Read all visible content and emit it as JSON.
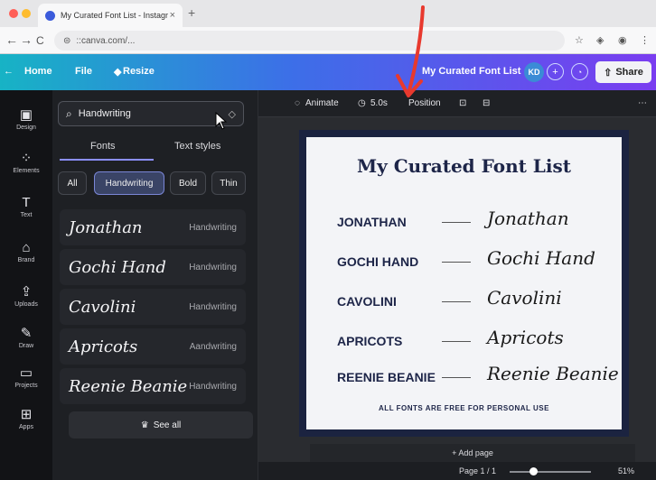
{
  "browser": {
    "tab_title": "My Curated Font List - Instagr",
    "tab_close": "×",
    "new_tab": "+",
    "url": "::canva.com/...",
    "nav_back": "←",
    "nav_forward": "→",
    "reload": "C"
  },
  "topbar": {
    "home": "Home",
    "file": "File",
    "resize": "Resize",
    "doc_title": "My Curated Font List",
    "avatar": "KD",
    "share": "Share"
  },
  "rail": [
    {
      "label": "Design",
      "icon": "▣"
    },
    {
      "label": "Elements",
      "icon": "⁘"
    },
    {
      "label": "Text",
      "icon": "T"
    },
    {
      "label": "Brand",
      "icon": "⌂"
    },
    {
      "label": "Uploads",
      "icon": "⇪"
    },
    {
      "label": "Draw",
      "icon": "✎"
    },
    {
      "label": "Projects",
      "icon": "▭"
    },
    {
      "label": "Apps",
      "icon": "⊞"
    }
  ],
  "panel": {
    "search_value": "Handwriting",
    "tabs": [
      "Fonts",
      "Text styles"
    ],
    "chips": [
      "All",
      "Handwriting",
      "Bold",
      "Thin"
    ],
    "fonts": [
      {
        "name": "Jonathan",
        "category": "Handwriting"
      },
      {
        "name": "Gochi Hand",
        "category": "Handwriting"
      },
      {
        "name": "Cavolini",
        "category": "Handwriting"
      },
      {
        "name": "Apricots",
        "category": "Aandwriting"
      },
      {
        "name": "Reenie Beanie",
        "category": "Handwriting"
      }
    ],
    "see_all": "See all"
  },
  "context_bar": {
    "animate": "Animate",
    "duration": "5.0s",
    "position": "Position"
  },
  "page": {
    "title": "My Curated Font List",
    "rows": [
      {
        "label": "JONATHAN",
        "sample": "Jonathan"
      },
      {
        "label": "GOCHI HAND",
        "sample": "Gochi Hand"
      },
      {
        "label": "CAVOLINI",
        "sample": "Cavolini"
      },
      {
        "label": "APRICOTS",
        "sample": "Apricots"
      },
      {
        "label": "REENIE BEANIE",
        "sample": "Reenie Beanie"
      }
    ],
    "footer": "ALL FONTS ARE FREE FOR PERSONAL USE"
  },
  "bottom": {
    "add_page": "+ Add page",
    "page_num": "Page 1 / 1",
    "zoom": "51%"
  },
  "colors": {
    "accent_arrow": "#e8392e",
    "brand_gradient_start": "#17b3c5",
    "brand_gradient_end": "#7a3df0",
    "page_frame": "#1b2340"
  }
}
